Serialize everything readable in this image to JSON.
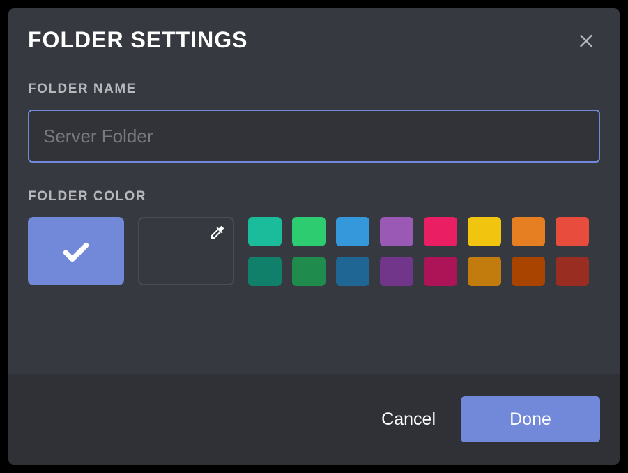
{
  "modal": {
    "title": "FOLDER SETTINGS",
    "name_section": {
      "label": "FOLDER NAME",
      "value": "",
      "placeholder": "Server Folder"
    },
    "color_section": {
      "label": "FOLDER COLOR",
      "selected_color": "#7289da",
      "palette": [
        "#1abc9c",
        "#2ecc71",
        "#3498db",
        "#9b59b6",
        "#e91e63",
        "#f1c40f",
        "#e67e22",
        "#e74c3c",
        "#11806a",
        "#1f8b4c",
        "#206694",
        "#71368a",
        "#ad1457",
        "#c27c0e",
        "#a84300",
        "#992d22"
      ]
    },
    "footer": {
      "cancel": "Cancel",
      "done": "Done"
    }
  }
}
